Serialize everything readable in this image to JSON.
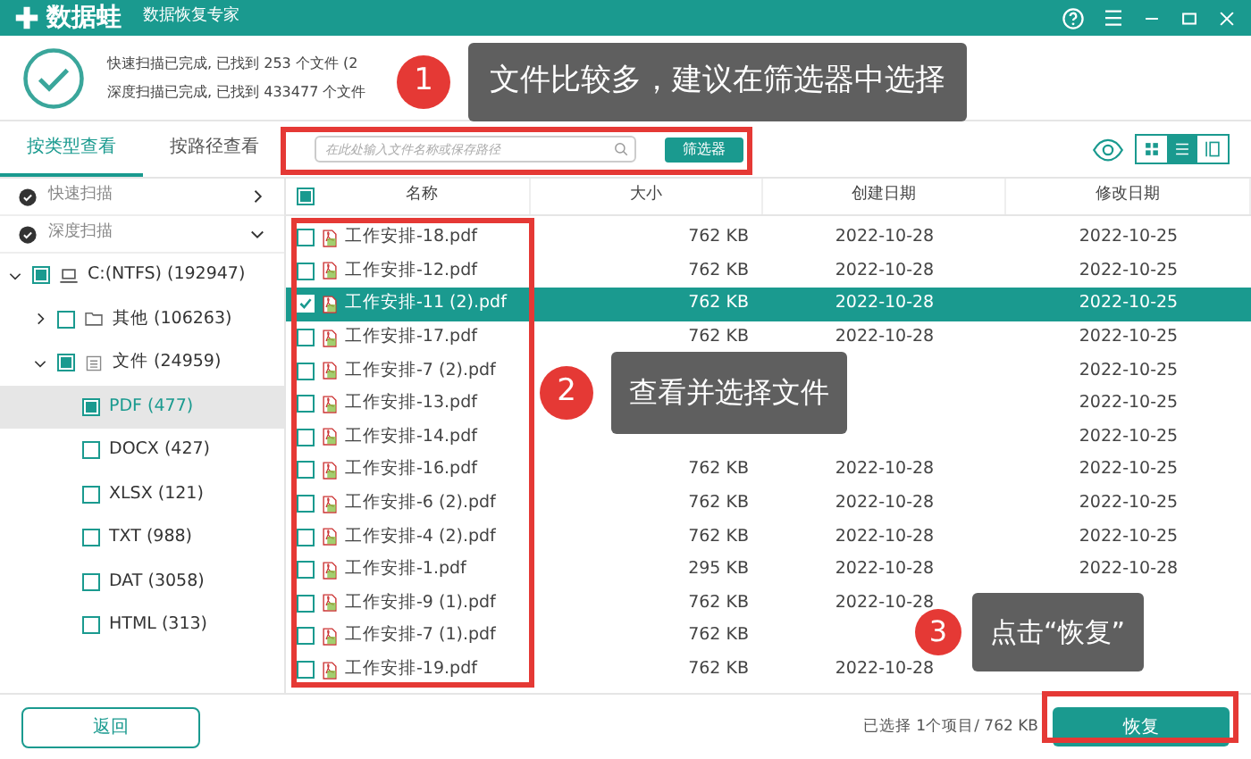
{
  "app": {
    "name": "数据蛙",
    "subtitle": "数据恢复专家"
  },
  "scan": {
    "lines": [
      "快速扫描已完成, 已找到 253 个文件 (2",
      "深度扫描已完成, 已找到 433477 个文件"
    ]
  },
  "tabs": [
    {
      "label": "按类型查看",
      "selected": true
    },
    {
      "label": "按路径查看",
      "selected": false
    }
  ],
  "search": {
    "placeholder": "在此处输入文件名称或保存路径"
  },
  "filter_button": "筛选器",
  "view_modes": [
    {
      "kind": "grid",
      "selected": false
    },
    {
      "kind": "list",
      "selected": true
    },
    {
      "kind": "columns",
      "selected": false
    }
  ],
  "scan_modes": [
    {
      "label": "快速扫描",
      "expanded": false
    },
    {
      "label": "深度扫描",
      "expanded": true
    }
  ],
  "tree": [
    {
      "label": "C:(NTFS) (192947)",
      "kind": "drive",
      "checked": true,
      "expanded": true,
      "selected": false,
      "children": [
        {
          "label": "其他 (106263)",
          "kind": "folder",
          "checked": false,
          "expanded": false,
          "selected": false
        },
        {
          "label": "文件 (24959)",
          "kind": "files",
          "checked": true,
          "expanded": true,
          "selected": false,
          "children": [
            {
              "label": "PDF (477)",
              "checked": true,
              "selected": true
            },
            {
              "label": "DOCX (427)",
              "checked": false,
              "selected": false
            },
            {
              "label": "XLSX (121)",
              "checked": false,
              "selected": false
            },
            {
              "label": "TXT (988)",
              "checked": false,
              "selected": false
            },
            {
              "label": "DAT (3058)",
              "checked": false,
              "selected": false
            },
            {
              "label": "HTML (313)",
              "checked": false,
              "selected": false
            }
          ]
        }
      ]
    }
  ],
  "table": {
    "header_checked": true,
    "columns": [
      "名称",
      "大小",
      "创建日期",
      "修改日期"
    ],
    "rows": [
      {
        "name": "工作安排-18.pdf",
        "size": "762 KB",
        "created": "2022-10-28",
        "modified": "2022-10-25",
        "checked": false,
        "selected": false
      },
      {
        "name": "工作安排-12.pdf",
        "size": "762 KB",
        "created": "2022-10-28",
        "modified": "2022-10-25",
        "checked": false,
        "selected": false
      },
      {
        "name": "工作安排-11 (2).pdf",
        "size": "762 KB",
        "created": "2022-10-28",
        "modified": "2022-10-25",
        "checked": true,
        "selected": true
      },
      {
        "name": "工作安排-17.pdf",
        "size": "762 KB",
        "created": "2022-10-28",
        "modified": "2022-10-25",
        "checked": false,
        "selected": false
      },
      {
        "name": "工作安排-7 (2).pdf",
        "modified": "2022-10-25",
        "checked": false,
        "selected": false
      },
      {
        "name": "工作安排-13.pdf",
        "modified": "2022-10-25",
        "checked": false,
        "selected": false
      },
      {
        "name": "工作安排-14.pdf",
        "modified": "2022-10-25",
        "checked": false,
        "selected": false
      },
      {
        "name": "工作安排-16.pdf",
        "size": "762 KB",
        "created": "2022-10-28",
        "modified": "2022-10-25",
        "checked": false,
        "selected": false
      },
      {
        "name": "工作安排-6 (2).pdf",
        "size": "762 KB",
        "created": "2022-10-28",
        "modified": "2022-10-25",
        "checked": false,
        "selected": false
      },
      {
        "name": "工作安排-4 (2).pdf",
        "size": "762 KB",
        "created": "2022-10-28",
        "modified": "2022-10-25",
        "checked": false,
        "selected": false
      },
      {
        "name": "工作安排-1.pdf",
        "size": "295 KB",
        "created": "2022-10-28",
        "modified": "2022-10-28",
        "checked": false,
        "selected": false
      },
      {
        "name": "工作安排-9 (1).pdf",
        "size": "762 KB",
        "created": "2022-10-28",
        "checked": false,
        "selected": false
      },
      {
        "name": "工作安排-7 (1).pdf",
        "size": "762 KB",
        "checked": false,
        "selected": false
      },
      {
        "name": "工作安排-19.pdf",
        "size": "762 KB",
        "created": "2022-10-28",
        "checked": false,
        "selected": false
      }
    ]
  },
  "back_button": "返回",
  "status": "已选择 1个项目/ 762 KB",
  "recover_button": "恢复",
  "callouts": [
    {
      "number": "1",
      "text": "文件比较多，建议在筛选器中选择"
    },
    {
      "number": "2",
      "text": "查看并选择文件"
    },
    {
      "number": "3",
      "text": "点击“恢复”"
    }
  ]
}
